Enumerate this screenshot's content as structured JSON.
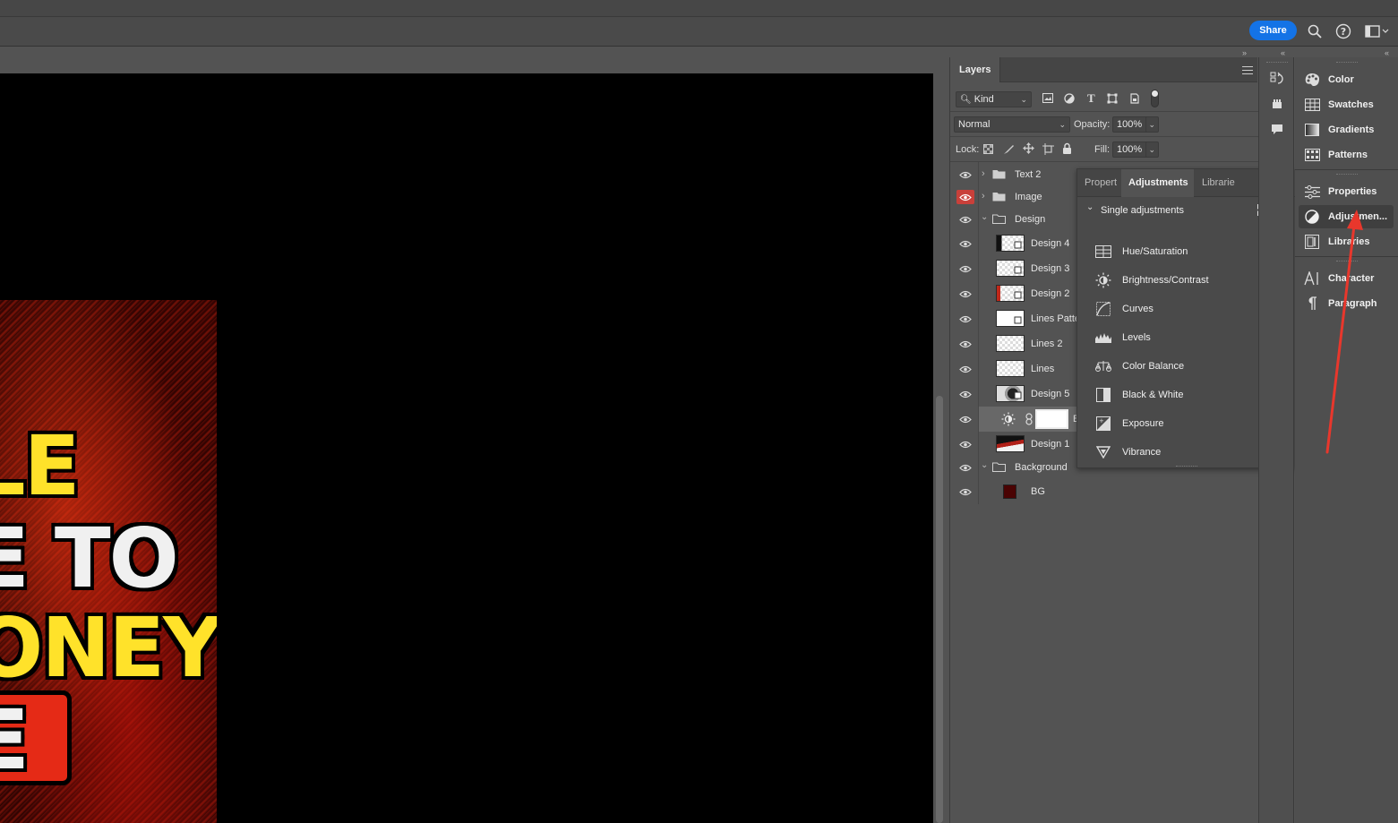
{
  "appbar": {
    "share_label": "Share",
    "icons": [
      "search-icon",
      "help-icon",
      "workspace-icon"
    ]
  },
  "canvas": {
    "art_lines": [
      "LE",
      "E TO",
      "ONEY",
      "E"
    ]
  },
  "layers_panel": {
    "tab_label": "Layers",
    "filter": {
      "kind": "Kind"
    },
    "blend_mode": "Normal",
    "opacity_label": "Opacity:",
    "opacity_value": "100%",
    "lock_label": "Lock:",
    "fill_label": "Fill:",
    "fill_value": "100%",
    "layers": [
      {
        "name": "Text 2",
        "type": "group",
        "expanded": false
      },
      {
        "name": "Image",
        "type": "group",
        "expanded": false
      },
      {
        "name": "Design",
        "type": "group",
        "expanded": true
      },
      {
        "name": "Design 4",
        "type": "smart"
      },
      {
        "name": "Design 3",
        "type": "smart"
      },
      {
        "name": "Design 2",
        "type": "smart"
      },
      {
        "name": "Lines Patte",
        "type": "smart"
      },
      {
        "name": "Lines 2",
        "type": "pixel"
      },
      {
        "name": "Lines",
        "type": "pixel"
      },
      {
        "name": "Design 5",
        "type": "smart"
      },
      {
        "name": "B",
        "type": "adjustment"
      },
      {
        "name": "Design 1",
        "type": "pixel"
      },
      {
        "name": "Background",
        "type": "group",
        "expanded": true
      },
      {
        "name": "BG",
        "type": "fill"
      }
    ]
  },
  "adjustments_panel": {
    "tabs": [
      "Propert",
      "Adjustments",
      "Librarie"
    ],
    "active_tab": "Adjustments",
    "section_label": "Single adjustments",
    "items": [
      {
        "label": "Hue/Saturation",
        "icon": "hue-saturation-icon"
      },
      {
        "label": "Brightness/Contrast",
        "icon": "brightness-contrast-icon"
      },
      {
        "label": "Curves",
        "icon": "curves-icon"
      },
      {
        "label": "Levels",
        "icon": "levels-icon"
      },
      {
        "label": "Color Balance",
        "icon": "color-balance-icon"
      },
      {
        "label": "Black & White",
        "icon": "black-white-icon"
      },
      {
        "label": "Exposure",
        "icon": "exposure-icon"
      },
      {
        "label": "Vibrance",
        "icon": "vibrance-icon"
      }
    ]
  },
  "dock": {
    "group1": [
      "Color",
      "Swatches",
      "Gradients",
      "Patterns"
    ],
    "group2": [
      "Properties",
      "Adjustmen...",
      "Libraries"
    ],
    "group3": [
      "Character",
      "Paragraph"
    ],
    "active": "Adjustmen..."
  },
  "colors": {
    "accent": "#1473e6",
    "annotation_arrow": "#e8372c",
    "eye_highlight": "#c9403a"
  }
}
